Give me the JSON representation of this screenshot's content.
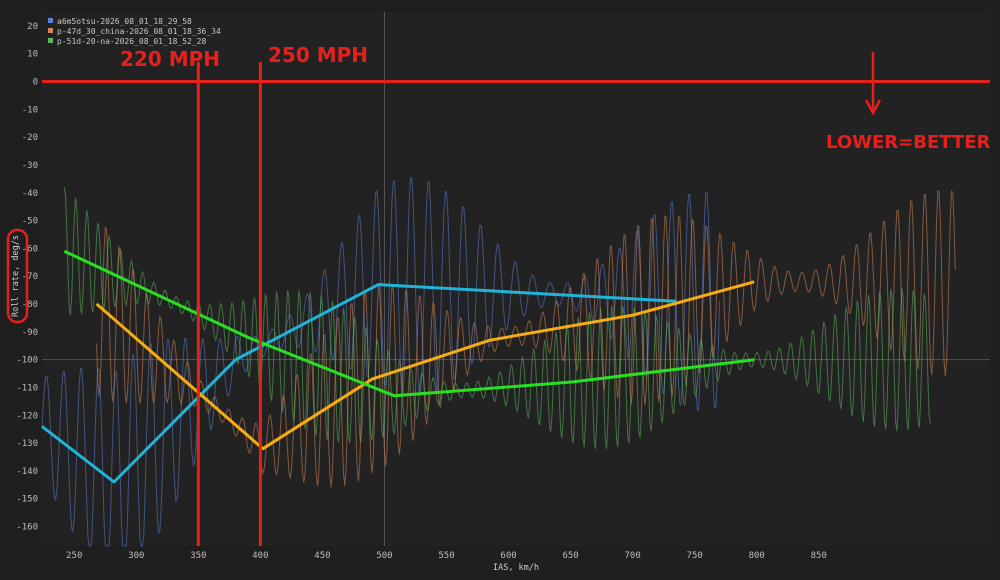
{
  "chart_data": {
    "type": "line",
    "xlabel": "IAS, km/h",
    "ylabel": "Roll rate, deg/s",
    "xlim": [
      224,
      988
    ],
    "ylim": [
      -167,
      25
    ],
    "x_ticks": [
      250,
      300,
      350,
      400,
      450,
      500,
      550,
      600,
      650,
      700,
      750,
      800,
      850
    ],
    "y_ticks": [
      20,
      10,
      0,
      -10,
      -20,
      -30,
      -40,
      -50,
      -60,
      -70,
      -80,
      -90,
      -100,
      -110,
      -120,
      -130,
      -140,
      -150,
      -160
    ],
    "grid": "major lines at x=500 and y=-100",
    "legend_position": "top-left",
    "series": [
      {
        "name": "a6m5otsu-2026_08_01_18_29_58",
        "color": "#5a7fd6",
        "trend_color": "#1fb4d8",
        "trend": {
          "x": [
            224,
            282,
            380,
            495,
            735
          ],
          "y": [
            -124,
            -144,
            -100,
            -73,
            -79
          ]
        }
      },
      {
        "name": "p-47d_30_china-2026_08_01_18_36_34",
        "color": "#d9865a",
        "trend_color": "#f7ac12",
        "trend": {
          "x": [
            268,
            402,
            490,
            585,
            700,
            798
          ],
          "y": [
            -80,
            -132,
            -107,
            -93,
            -84,
            -72
          ]
        }
      },
      {
        "name": "p-51d-20-na-2026_08_01_18_52_28",
        "color": "#5fb85f",
        "trend_color": "#28e022",
        "trend": {
          "x": [
            242,
            390,
            508,
            652,
            798
          ],
          "y": [
            -61,
            -92,
            -113,
            -108,
            -100
          ]
        }
      }
    ]
  },
  "annotations": {
    "speed_220": "220 MPH",
    "speed_250": "250 MPH",
    "lower_better": "LOWER=BETTER",
    "marker_x": [
      350,
      400
    ],
    "zero_line_y": 0,
    "color": "#e8201c"
  }
}
